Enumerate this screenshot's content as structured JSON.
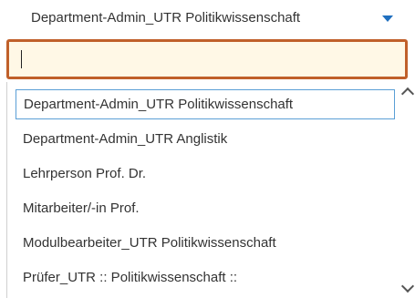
{
  "select": {
    "current_value": "Department-Admin_UTR Politikwissenschaft",
    "caret_icon": "chevron-down-icon",
    "accent_color": "#1f6fbf"
  },
  "search": {
    "value": "",
    "placeholder": "",
    "border_color": "#c0602a",
    "background_color": "#fff8e6"
  },
  "dropdown": {
    "options": [
      {
        "label": "Department-Admin_UTR Politikwissenschaft",
        "selected": true
      },
      {
        "label": "Department-Admin_UTR Anglistik",
        "selected": false
      },
      {
        "label": "Lehrperson Prof. Dr.",
        "selected": false
      },
      {
        "label": "Mitarbeiter/-in Prof.",
        "selected": false
      },
      {
        "label": "Modulbearbeiter_UTR Politikwissenschaft",
        "selected": false
      },
      {
        "label": "Prüfer_UTR :: Politikwissenschaft ::",
        "selected": false
      }
    ],
    "scroll_up_icon": "chevron-up-icon",
    "scroll_down_icon": "chevron-down-icon"
  }
}
